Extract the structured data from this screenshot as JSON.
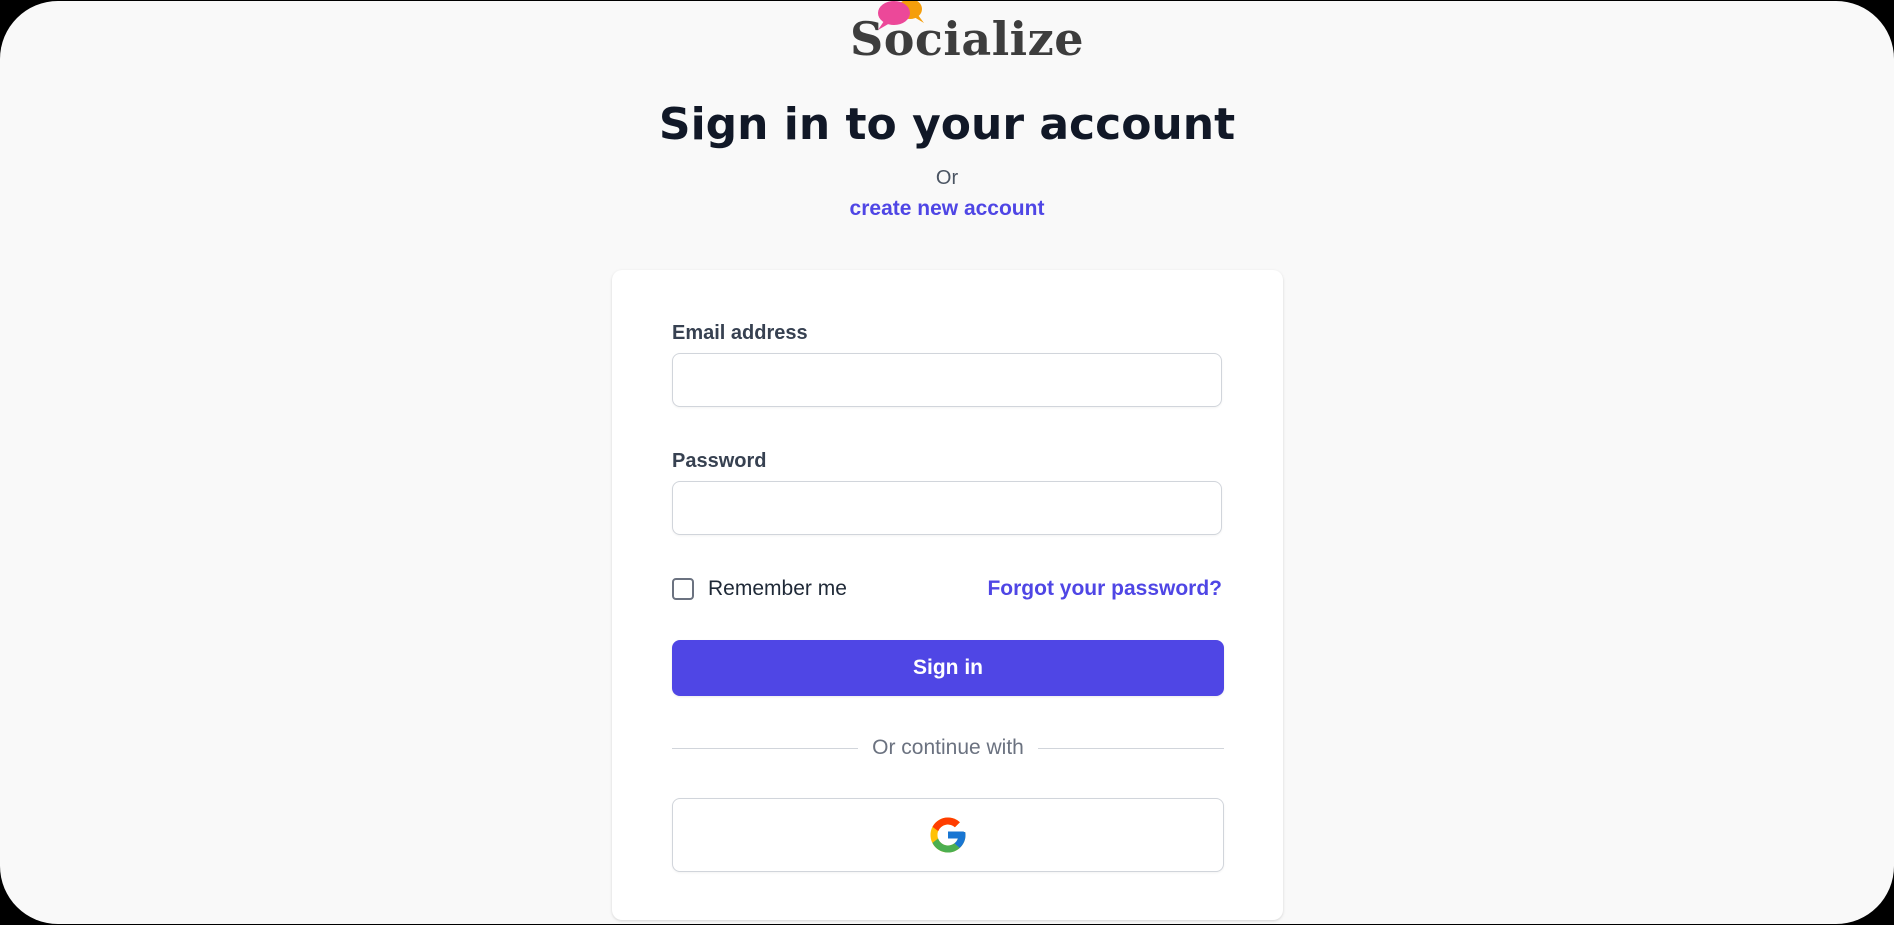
{
  "brand": {
    "name": "Socialize",
    "icon": "speech-bubbles-icon",
    "bubble_colors": [
      "#ec4899",
      "#f59e0b"
    ]
  },
  "header": {
    "title": "Sign in to your account",
    "or_text": "Or",
    "create_account_link": "create new account"
  },
  "form": {
    "email_label": "Email address",
    "email_value": "",
    "password_label": "Password",
    "password_value": "",
    "remember_label": "Remember me",
    "remember_checked": false,
    "forgot_link": "Forgot your password?",
    "submit_label": "Sign in",
    "divider_text": "Or continue with",
    "social_provider_icon": "google-icon"
  },
  "colors": {
    "accent": "#4f46e5",
    "background": "#f9f9f9",
    "card": "#ffffff",
    "title": "#111827"
  }
}
